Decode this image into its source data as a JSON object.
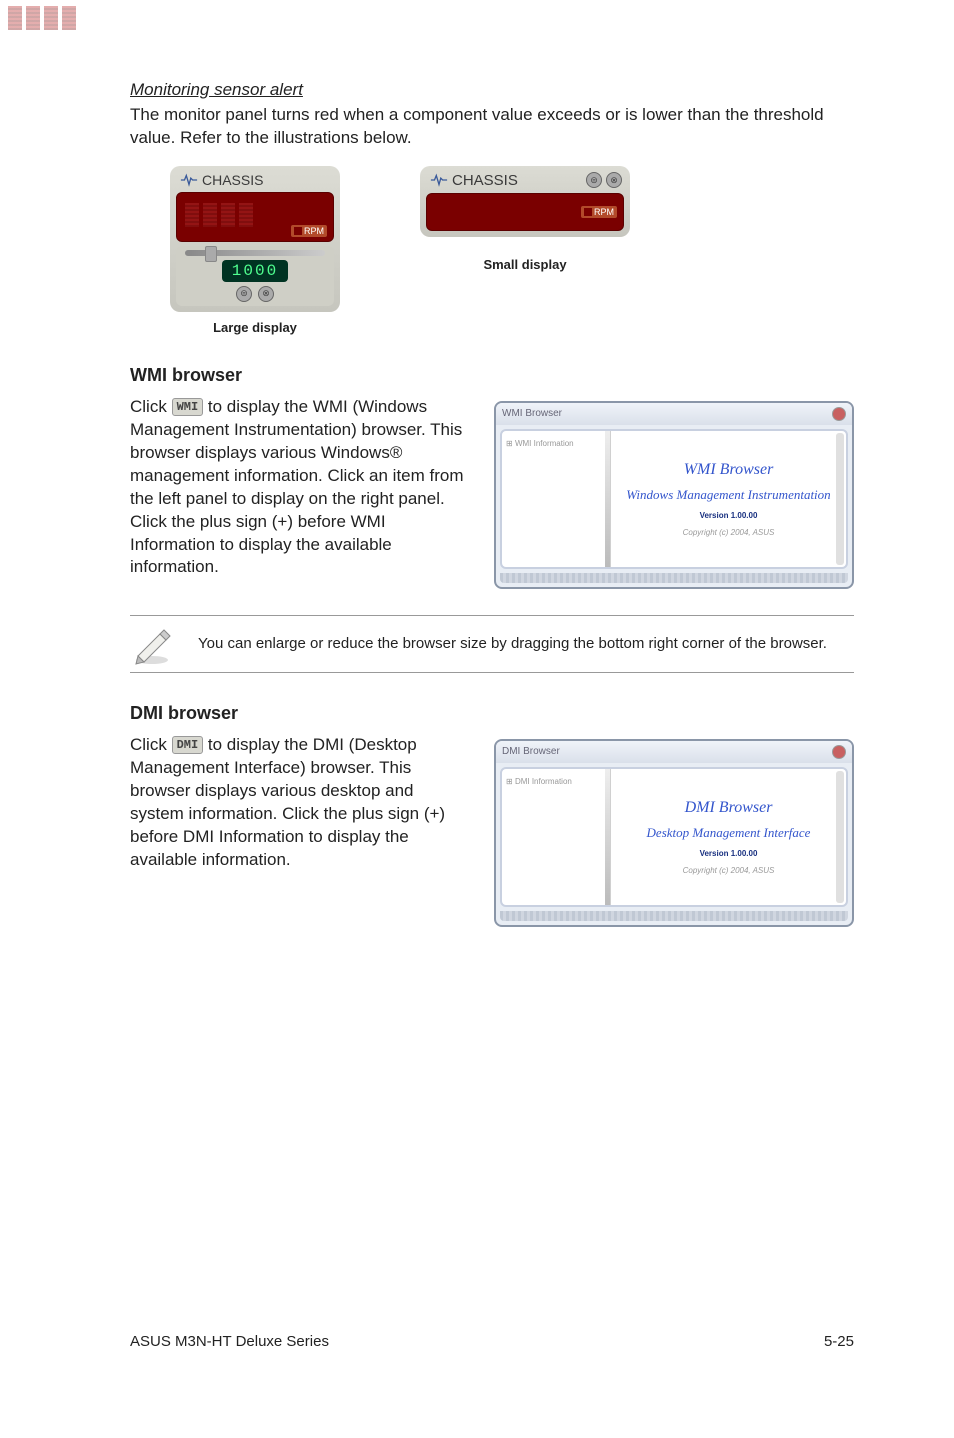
{
  "section1": {
    "title": "Monitoring sensor alert",
    "body": "The monitor panel turns red when a component value exceeds or is lower than the threshold value. Refer to the illustrations below."
  },
  "display": {
    "chassis_label": "CHASSIS",
    "rpm_label": "RPM",
    "value": "1000",
    "large_caption": "Large display",
    "small_caption": "Small display"
  },
  "wmi": {
    "heading": "WMI browser",
    "btn": "WMI",
    "body_prefix": "Click ",
    "body_suffix": " to display the WMI (Windows Management Instrumentation) browser. This browser displays various Windows® management information. Click an item from the left panel to display on the right panel. Click the plus sign (+) before WMI Information to display the available information.",
    "win_title": "WMI Browser",
    "tree_root": "WMI Information",
    "panel_title": "WMI Browser",
    "panel_subtitle": "Windows Management Instrumentation",
    "version": "Version 1.00.00",
    "copyright": "Copyright (c) 2004, ASUS"
  },
  "note": {
    "text": "You can enlarge or reduce the browser size by dragging the bottom right corner of the browser."
  },
  "dmi": {
    "heading": "DMI browser",
    "btn": "DMI",
    "body_prefix": "Click ",
    "body_suffix": " to display the DMI (Desktop Management Interface) browser. This browser displays various desktop and system information. Click the plus sign (+) before DMI Information to display the available information.",
    "win_title": "DMI Browser",
    "tree_root": "DMI Information",
    "panel_title": "DMI Browser",
    "panel_subtitle": "Desktop Management Interface",
    "version": "Version 1.00.00",
    "copyright": "Copyright (c) 2004, ASUS"
  },
  "footer": {
    "left": "ASUS M3N-HT Deluxe Series",
    "right": "5-25"
  }
}
